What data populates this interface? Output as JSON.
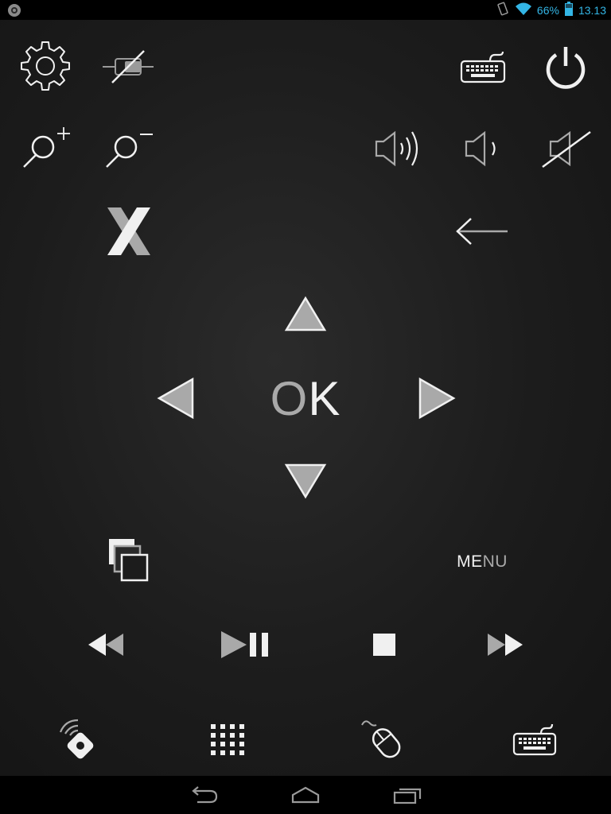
{
  "status_bar": {
    "battery_percent": "66%",
    "time": "13.13",
    "icons": [
      "notification-icon",
      "vibrate-icon",
      "wifi-icon",
      "battery-icon"
    ]
  },
  "remote": {
    "ok_label": {
      "part1": "O",
      "part2": "K"
    },
    "menu_label": {
      "part1": "ME",
      "part2": "NU"
    },
    "icons": {
      "settings": "gear-icon",
      "disconnected": "disconnected-plug-icon",
      "keyboard": "keyboard-icon",
      "power": "power-icon",
      "zoom_in": "zoom-in-icon",
      "zoom_out": "zoom-out-icon",
      "volume_up": "volume-up-icon",
      "volume_down": "volume-down-icon",
      "mute": "mute-icon",
      "close": "x-icon",
      "back": "back-arrow-icon",
      "up": "arrow-up-icon",
      "down": "arrow-down-icon",
      "left": "arrow-left-icon",
      "right": "arrow-right-icon",
      "windows": "windows-icon",
      "rewind": "rewind-icon",
      "play_pause": "play-pause-icon",
      "stop": "stop-icon",
      "fast_forward": "fast-forward-icon"
    }
  },
  "bottom_bar": {
    "icons": [
      "remote-mode-icon",
      "numpad-icon",
      "mouse-icon",
      "keyboard-icon"
    ]
  },
  "nav_bar": {
    "icons": [
      "back-icon",
      "home-icon",
      "recent-apps-icon"
    ]
  },
  "colors": {
    "status_accent": "#33b5e5",
    "icon_white": "#f0f0f0",
    "icon_gray": "#a9a9a9",
    "background": "#1c1c1c"
  }
}
